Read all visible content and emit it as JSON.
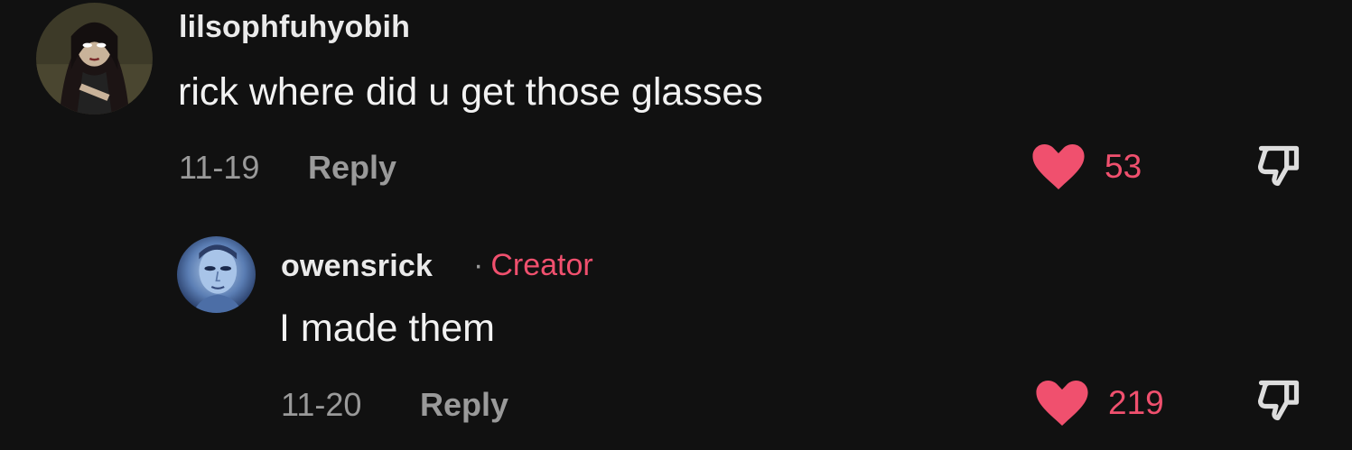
{
  "comments": [
    {
      "username": "lilsophfuhyobih",
      "text": "rick where did u get those glasses",
      "date": "11-19",
      "reply_label": "Reply",
      "like_count": "53",
      "liked": true,
      "avatar_icon": "avatar-cartoon-girl"
    },
    {
      "username": "owensrick",
      "separator": "·",
      "badge": "Creator",
      "text": "I made them",
      "date": "11-20",
      "reply_label": "Reply",
      "like_count": "219",
      "liked": true,
      "avatar_icon": "avatar-blue-face"
    }
  ],
  "colors": {
    "background": "#111111",
    "accent": "#f0506e",
    "muted_text": "#9a9a9a"
  }
}
